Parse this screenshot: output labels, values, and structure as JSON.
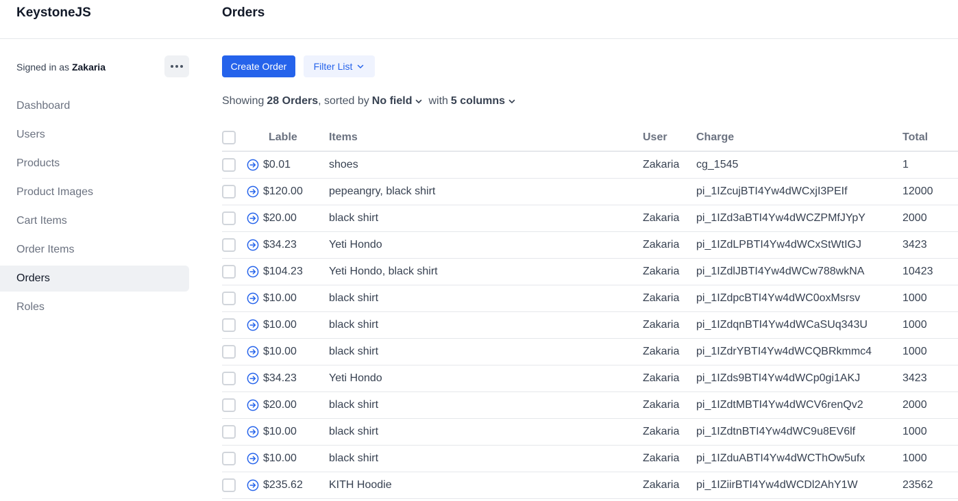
{
  "sidebar": {
    "brand": "KeystoneJS",
    "signed_in_prefix": "Signed in as",
    "user": "Zakaria",
    "nav": [
      {
        "label": "Dashboard",
        "active": false
      },
      {
        "label": "Users",
        "active": false
      },
      {
        "label": "Products",
        "active": false
      },
      {
        "label": "Product Images",
        "active": false
      },
      {
        "label": "Cart Items",
        "active": false
      },
      {
        "label": "Order Items",
        "active": false
      },
      {
        "label": "Orders",
        "active": true
      },
      {
        "label": "Roles",
        "active": false
      }
    ]
  },
  "header": {
    "title": "Orders"
  },
  "toolbar": {
    "create_label": "Create Order",
    "filter_label": "Filter List"
  },
  "summary": {
    "showing": "Showing",
    "count": "28 Orders",
    "sorted_by": ", sorted by",
    "sort_field": "No field",
    "with": "with",
    "columns": "5 columns"
  },
  "table": {
    "columns": [
      "Lable",
      "Items",
      "User",
      "Charge",
      "Total"
    ],
    "rows": [
      {
        "label": "$0.01",
        "items": "shoes",
        "user": "Zakaria",
        "charge": "cg_1545",
        "total": "1"
      },
      {
        "label": "$120.00",
        "items": "pepeangry, black shirt",
        "user": "",
        "charge": "pi_1IZcujBTI4Yw4dWCxjI3PEIf",
        "total": "12000"
      },
      {
        "label": "$20.00",
        "items": "black shirt",
        "user": "Zakaria",
        "charge": "pi_1IZd3aBTI4Yw4dWCZPMfJYpY",
        "total": "2000"
      },
      {
        "label": "$34.23",
        "items": "Yeti Hondo",
        "user": "Zakaria",
        "charge": "pi_1IZdLPBTI4Yw4dWCxStWtIGJ",
        "total": "3423"
      },
      {
        "label": "$104.23",
        "items": "Yeti Hondo, black shirt",
        "user": "Zakaria",
        "charge": "pi_1IZdlJBTI4Yw4dWCw788wkNA",
        "total": "10423"
      },
      {
        "label": "$10.00",
        "items": "black shirt",
        "user": "Zakaria",
        "charge": "pi_1IZdpcBTI4Yw4dWC0oxMsrsv",
        "total": "1000"
      },
      {
        "label": "$10.00",
        "items": "black shirt",
        "user": "Zakaria",
        "charge": "pi_1IZdqnBTI4Yw4dWCaSUq343U",
        "total": "1000"
      },
      {
        "label": "$10.00",
        "items": "black shirt",
        "user": "Zakaria",
        "charge": "pi_1IZdrYBTI4Yw4dWCQBRkmmc4",
        "total": "1000"
      },
      {
        "label": "$34.23",
        "items": "Yeti Hondo",
        "user": "Zakaria",
        "charge": "pi_1IZds9BTI4Yw4dWCp0gi1AKJ",
        "total": "3423"
      },
      {
        "label": "$20.00",
        "items": "black shirt",
        "user": "Zakaria",
        "charge": "pi_1IZdtMBTI4Yw4dWCV6renQv2",
        "total": "2000"
      },
      {
        "label": "$10.00",
        "items": "black shirt",
        "user": "Zakaria",
        "charge": "pi_1IZdtnBTI4Yw4dWC9u8EV6lf",
        "total": "1000"
      },
      {
        "label": "$10.00",
        "items": "black shirt",
        "user": "Zakaria",
        "charge": "pi_1IZduABTI4Yw4dWCThOw5ufx",
        "total": "1000"
      },
      {
        "label": "$235.62",
        "items": "KITH Hoodie",
        "user": "Zakaria",
        "charge": "pi_1IZiirBTI4Yw4dWCDl2AhY1W",
        "total": "23562"
      }
    ]
  },
  "icons": {
    "more": "more-horizontal-icon",
    "row_link": "arrow-circle-right-icon",
    "chevron": "chevron-down-icon"
  },
  "colors": {
    "primary": "#2563eb",
    "active_nav_bg": "#eff1f4",
    "border": "#e5e7eb"
  }
}
